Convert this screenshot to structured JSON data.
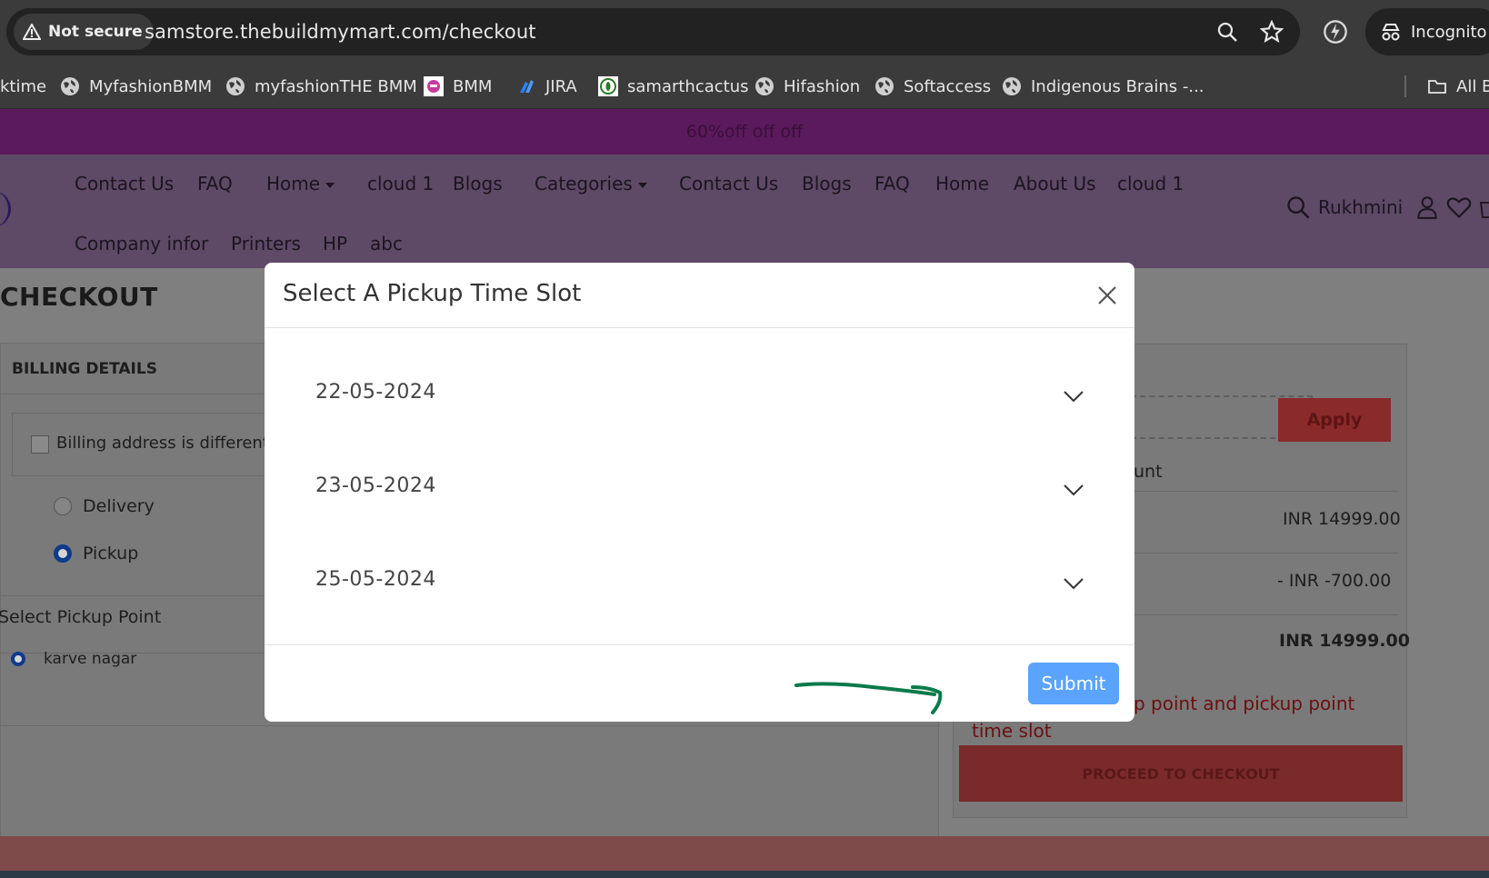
{
  "browser": {
    "security_label": "Not secure",
    "url": "samstore.thebuildmymart.com/checkout",
    "incognito_label": "Incognito",
    "bookmarks": [
      {
        "label": "ktime",
        "icon": "none"
      },
      {
        "label": "MyfashionBMM",
        "icon": "globe-icon"
      },
      {
        "label": "myfashionTHE BMM",
        "icon": "globe-icon"
      },
      {
        "label": "BMM",
        "icon": "bmm-favicon-icon"
      },
      {
        "label": "JIRA",
        "icon": "jira-icon"
      },
      {
        "label": "samarthcactus",
        "icon": "cactus-favicon-icon"
      },
      {
        "label": "Hifashion",
        "icon": "globe-icon"
      },
      {
        "label": "Softaccess",
        "icon": "globe-icon"
      },
      {
        "label": "Indigenous Brains -...",
        "icon": "globe-icon"
      },
      {
        "label": "All B",
        "icon": "folder-icon"
      }
    ]
  },
  "promo": {
    "text": "60%off off off"
  },
  "nav": {
    "row1": [
      "Contact Us",
      "FAQ",
      "Home",
      "cloud 1",
      "Blogs",
      "Categories",
      "Contact Us",
      "Blogs",
      "FAQ",
      "Home",
      "About Us",
      "cloud 1"
    ],
    "row2": [
      "Company infor",
      "Printers",
      "HP",
      "abc"
    ],
    "user_name": "Rukhmini"
  },
  "checkout": {
    "title": "CHECKOUT",
    "billing_header": "BILLING DETAILS",
    "billing_different_label": "Billing address is different",
    "delivery_label": "Delivery",
    "pickup_label": "Pickup",
    "pickup_point_header": "Select Pickup Point",
    "pickup_point_option": "karve nagar"
  },
  "summary": {
    "apply_label": "Apply",
    "partial_label": "unt",
    "subtotal": "INR 14999.00",
    "discount": "- INR -700.00",
    "total": "INR 14999.00",
    "error_line1": "p point and pickup point",
    "error_line2": "time slot",
    "proceed_label": "PROCEED TO CHECKOUT"
  },
  "modal": {
    "title": "Select A Pickup Time Slot",
    "dates": [
      "22-05-2024",
      "23-05-2024",
      "25-05-2024"
    ],
    "submit_label": "Submit"
  },
  "colors": {
    "submit_bg": "#5aa3ff",
    "promo_bg": "#5b1a5c",
    "nav_bg": "#5e4966",
    "apply_bg": "#8a2a2a",
    "annotation_arrow": "#0a7a4a"
  }
}
